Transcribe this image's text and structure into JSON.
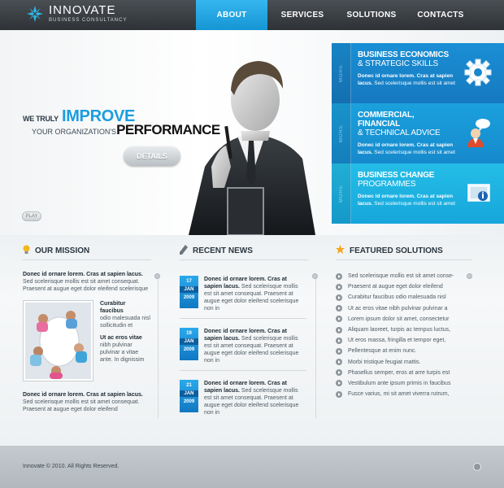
{
  "brand": {
    "title": "INNOVATE",
    "subtitle": "BUSINESS CONSULTANCY"
  },
  "nav": {
    "about": "ABOUT",
    "services": "SERVICES",
    "solutions": "SOLUTIONS",
    "contacts": "CONTACTS"
  },
  "hero": {
    "line1_prefix": "WE TRULY",
    "line1_big": "IMPROVE",
    "line2_prefix": "YOUR ORGANIZATION'S",
    "line2_big": "PERFORMANCE",
    "details_label": "DETAILS",
    "play_label": "PLAY"
  },
  "panels": [
    {
      "more": "MORE",
      "title_bold": "BUSINESS ECONOMICS",
      "title_light": "& STRATEGIC SKILLS",
      "text_bold": "Donec id ornare lorem. Cras at sapien lacus.",
      "text": "Sed scelerisque mollis est sit amet",
      "icon": "gear-icon"
    },
    {
      "more": "MORE",
      "title_bold": "COMMERCIAL, FINANCIAL",
      "title_light": "& TECHNICAL ADVICE",
      "text_bold": "Donec id ornare lorem. Cras at sapien lacus.",
      "text": "Sed scelerisque mollis est sit amet",
      "icon": "advisor-icon"
    },
    {
      "more": "MORE",
      "title_bold": "BUSINESS CHANGE",
      "title_light": "PROGRAMMES",
      "text_bold": "Donec id ornare lorem. Cras at sapien lacus.",
      "text": "Sed scelerisque mollis est sit amet",
      "icon": "presentation-icon"
    }
  ],
  "mission": {
    "heading": "OUR MISSION",
    "intro_bold": "Donec id ornare lorem. Cras at sapien lacus.",
    "intro": "Sed scelerisque mollis est sit amet consequat. Praesent at augue eget dolor eleifend scelerisque",
    "side1_bold": "Curabitur faucibus",
    "side1": "odio malesuada nisl sollicitudin et",
    "side2_bold": "Ut ac eros vitae",
    "side2": "nibh pulvinar pulvinar a vitae ante. In dignissim",
    "bottom_bold": "Donec id ornare lorem. Cras at sapien lacus.",
    "bottom": "Sed scelerisque mollis est sit amet consequat. Praesent at augue eget dolor eleifend"
  },
  "news": {
    "heading": "RECENT NEWS",
    "items": [
      {
        "day": "17",
        "month": "JAN",
        "year": "2009",
        "bold": "Donec id ornare lorem. Cras at sapien lacus.",
        "text": "Sed scelerisque mollis est sit amet consequat. Praesent at augue eget dolor eleifend scelerisque non in"
      },
      {
        "day": "19",
        "month": "JAN",
        "year": "2009",
        "bold": "Donec id ornare lorem. Cras at sapien lacus.",
        "text": "Sed scelerisque mollis est sit amet consequat. Praesent at augue eget dolor eleifend scelerisque non in"
      },
      {
        "day": "21",
        "month": "JAN",
        "year": "2009",
        "bold": "Donec id ornare lorem. Cras at sapien lacus.",
        "text": "Sed scelerisque mollis est sit amet consequat. Praesent at augue eget dolor eleifend scelerisque non in"
      }
    ]
  },
  "solutions": {
    "heading": "FEATURED SOLUTIONS",
    "items": [
      "Sed scelerisque mollis est sit amet conse-",
      "Praesent at augue eget dolor eleifend",
      "Curabitur faucibus odio malesuada nisl",
      "Ut ac eros vitae nibh pulvinar pulvinar a",
      "Lorem ipsum dolor sit amet, consectetur",
      "Aliquam laoreet, turpis ac tempus luctus,",
      "Ut eros massa, fringilla et tempor eget,",
      "Pellentesque at enim nunc.",
      "Morbi tristique feugiat mattis.",
      "Phasellus semper, eros at arre turpis est",
      "Vestibulum ante ipsum primis in faucibus",
      "Fusce varius, mi sit amet viverra rutrum,"
    ]
  },
  "footer": {
    "copyright": "Innovate © 2010. All Rights Reserved."
  }
}
